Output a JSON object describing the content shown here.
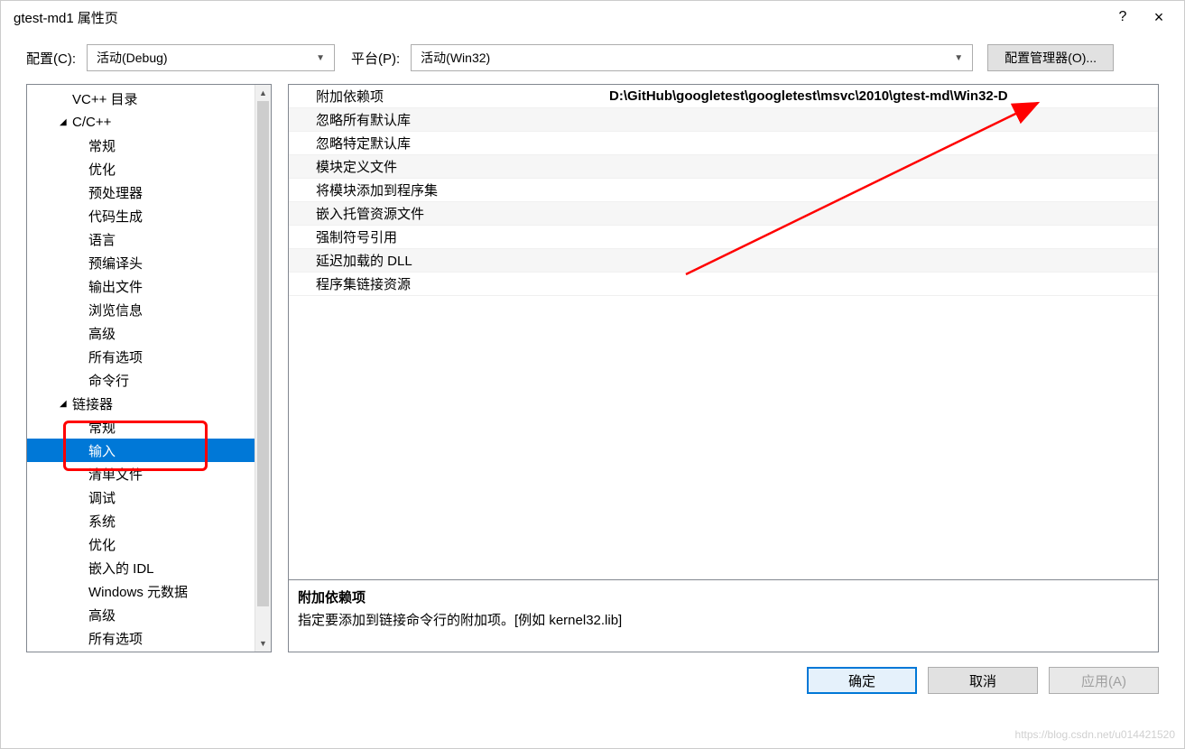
{
  "window": {
    "title": "gtest-md1 属性页",
    "help": "?",
    "close": "×"
  },
  "config": {
    "label_config": "配置(C):",
    "config_value": "活动(Debug)",
    "label_platform": "平台(P):",
    "platform_value": "活动(Win32)",
    "manager_btn": "配置管理器(O)..."
  },
  "tree": [
    {
      "label": "VC++ 目录",
      "level": 2
    },
    {
      "label": "C/C++",
      "level": 2,
      "expanded": true
    },
    {
      "label": "常规",
      "level": 3
    },
    {
      "label": "优化",
      "level": 3
    },
    {
      "label": "预处理器",
      "level": 3
    },
    {
      "label": "代码生成",
      "level": 3
    },
    {
      "label": "语言",
      "level": 3
    },
    {
      "label": "预编译头",
      "level": 3
    },
    {
      "label": "输出文件",
      "level": 3
    },
    {
      "label": "浏览信息",
      "level": 3
    },
    {
      "label": "高级",
      "level": 3
    },
    {
      "label": "所有选项",
      "level": 3
    },
    {
      "label": "命令行",
      "level": 3
    },
    {
      "label": "链接器",
      "level": 2,
      "expanded": true
    },
    {
      "label": "常规",
      "level": 3
    },
    {
      "label": "输入",
      "level": 3,
      "selected": true
    },
    {
      "label": "清单文件",
      "level": 3
    },
    {
      "label": "调试",
      "level": 3
    },
    {
      "label": "系统",
      "level": 3
    },
    {
      "label": "优化",
      "level": 3
    },
    {
      "label": "嵌入的 IDL",
      "level": 3
    },
    {
      "label": "Windows 元数据",
      "level": 3
    },
    {
      "label": "高级",
      "level": 3
    },
    {
      "label": "所有选项",
      "level": 3
    }
  ],
  "props": [
    {
      "name": "附加依赖项",
      "value": "D:\\GitHub\\googletest\\googletest\\msvc\\2010\\gtest-md\\Win32-D"
    },
    {
      "name": "忽略所有默认库",
      "value": ""
    },
    {
      "name": "忽略特定默认库",
      "value": ""
    },
    {
      "name": "模块定义文件",
      "value": ""
    },
    {
      "name": "将模块添加到程序集",
      "value": ""
    },
    {
      "name": "嵌入托管资源文件",
      "value": ""
    },
    {
      "name": "强制符号引用",
      "value": ""
    },
    {
      "name": "延迟加载的 DLL",
      "value": ""
    },
    {
      "name": "程序集链接资源",
      "value": ""
    }
  ],
  "desc": {
    "title": "附加依赖项",
    "text": "指定要添加到链接命令行的附加项。[例如 kernel32.lib]"
  },
  "buttons": {
    "ok": "确定",
    "cancel": "取消",
    "apply": "应用(A)"
  },
  "watermark": "https://blog.csdn.net/u014421520"
}
